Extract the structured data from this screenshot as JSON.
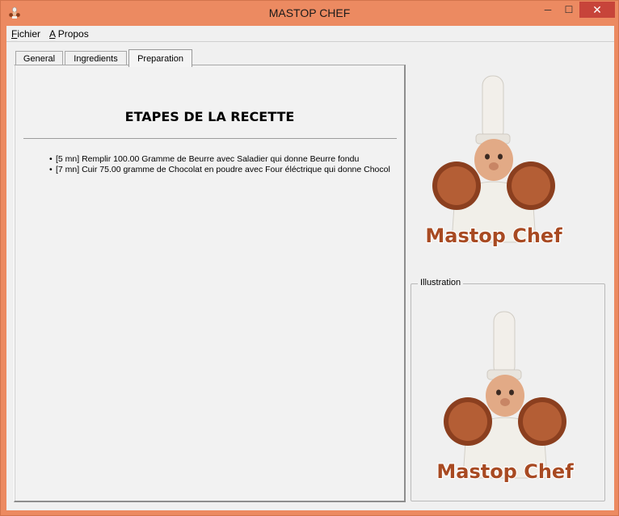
{
  "window": {
    "title": "MASTOP CHEF",
    "controls": {
      "minimize": "─",
      "maximize": "☐",
      "close": "✕"
    }
  },
  "menu": {
    "items": [
      {
        "access": "F",
        "rest": "ichier"
      },
      {
        "access": "A",
        "rest": " Propos"
      }
    ]
  },
  "tabs": {
    "general": "General",
    "ingredients": "Ingredients",
    "preparation": "Preparation",
    "selected": "Preparation"
  },
  "preparation": {
    "heading": "ETAPES DE LA RECETTE",
    "steps": [
      "[5 mn] Remplir 100.00 Gramme de Beurre avec Saladier qui donne Beurre fondu",
      "[7 mn] Cuir 75.00 gramme de Chocolat en poudre avec Four éléctrique qui donne Chocol"
    ]
  },
  "logo": {
    "text": "Mastop Chef"
  },
  "illustration": {
    "legend": "Illustration",
    "text": "Mastop Chef"
  },
  "icons": {
    "app": "chef-app-icon",
    "logo": "chef-logo-image",
    "illustration": "chef-illustration-image"
  },
  "colors": {
    "window_border": "#ec8a61",
    "close_button": "#c7443a",
    "logo_text": "#a84a22"
  }
}
